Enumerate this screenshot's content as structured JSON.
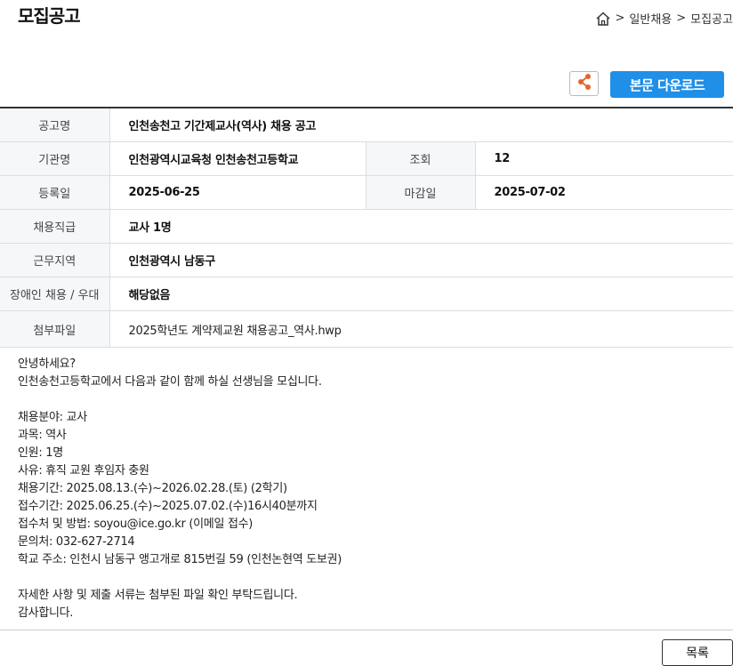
{
  "header": {
    "title": "모집공고",
    "breadcrumb": [
      "일반채용",
      "모집공고"
    ],
    "breadcrumb_sep": ">"
  },
  "toolbar": {
    "share_icon": "share-icon",
    "download_label": "본문 다운로드"
  },
  "info": {
    "title_label": "공고명",
    "title_value": "인천송천고 기간제교사(역사) 채용 공고",
    "org_label": "기관명",
    "org_value": "인천광역시교육청 인천송천고등학교",
    "views_label": "조회",
    "views_value": "12",
    "reg_label": "등록일",
    "reg_value": "2025-06-25",
    "deadline_label": "마감일",
    "deadline_value": "2025-07-02",
    "position_label": "채용직급",
    "position_value": "교사 1명",
    "region_label": "근무지역",
    "region_value": "인천광역시 남동구",
    "disabled_label": "장애인 채용 / 우대",
    "disabled_value": "해당없음",
    "attach_label": "첨부파일",
    "attach_value": "2025학년도 계약제교원 채용공고_역사.hwp"
  },
  "body": {
    "lines": [
      "안녕하세요?",
      "인천송천고등학교에서 다음과 같이 함께 하실 선생님을 모십니다.",
      "",
      "채용분야: 교사",
      "과목: 역사",
      "인원: 1명",
      "사유: 휴직 교원 후임자 충원",
      "채용기간: 2025.08.13.(수)~2026.02.28.(토) (2학기)",
      "접수기간: 2025.06.25.(수)~2025.07.02.(수)16시40분까지",
      "접수처 및 방법: soyou@ice.go.kr (이메일 접수)",
      "문의처: 032-627-2714",
      "학교 주소: 인천시 남동구 앵고개로 815번길 59 (인천논현역 도보권)",
      "",
      "자세한 사항 및 제출 서류는 첨부된 파일 확인 부탁드립니다.",
      "감사합니다."
    ]
  },
  "footer": {
    "list_label": "목록"
  }
}
